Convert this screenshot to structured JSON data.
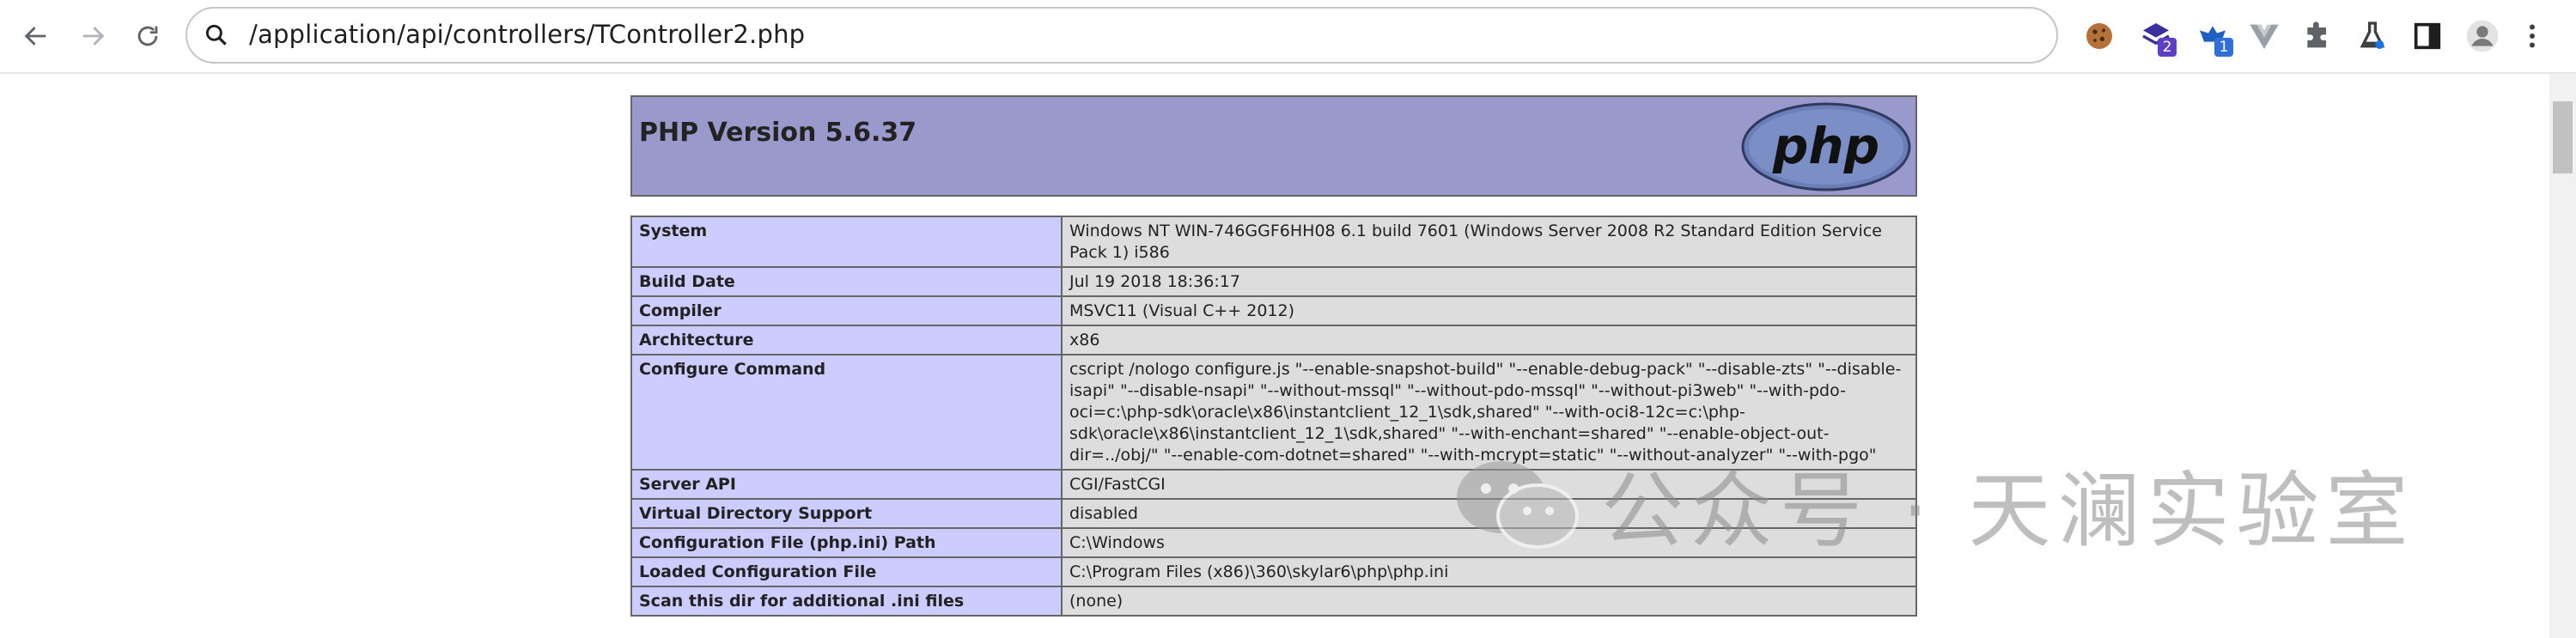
{
  "browser": {
    "url": "/application/api/controllers/TController2.php",
    "extensions": [
      {
        "name": "cookie-extension-icon"
      },
      {
        "name": "stack-extension-icon",
        "badge": "2"
      },
      {
        "name": "bird-extension-icon",
        "badge": "1"
      },
      {
        "name": "vue-devtools-icon"
      },
      {
        "name": "extensions-puzzle-icon"
      },
      {
        "name": "lab-flask-icon"
      },
      {
        "name": "side-panel-icon"
      },
      {
        "name": "profile-avatar-icon"
      },
      {
        "name": "more-menu-icon"
      }
    ],
    "colors": {
      "badge_blue": "#2f6fd6",
      "badge_purple": "#5b3fc4"
    }
  },
  "phpinfo": {
    "version_title": "PHP Version 5.6.37",
    "logo_text": "php",
    "rows": [
      {
        "label": "System",
        "value": "Windows NT WIN-746GGF6HH08 6.1 build 7601 (Windows Server 2008 R2 Standard Edition Service Pack 1) i586"
      },
      {
        "label": "Build Date",
        "value": "Jul 19 2018 18:36:17"
      },
      {
        "label": "Compiler",
        "value": "MSVC11 (Visual C++ 2012)"
      },
      {
        "label": "Architecture",
        "value": "x86"
      },
      {
        "label": "Configure Command",
        "value": "cscript /nologo configure.js \"--enable-snapshot-build\" \"--enable-debug-pack\" \"--disable-zts\" \"--disable-isapi\" \"--disable-nsapi\" \"--without-mssql\" \"--without-pdo-mssql\" \"--without-pi3web\" \"--with-pdo-oci=c:\\php-sdk\\oracle\\x86\\instantclient_12_1\\sdk,shared\" \"--with-oci8-12c=c:\\php-sdk\\oracle\\x86\\instantclient_12_1\\sdk,shared\" \"--with-enchant=shared\" \"--enable-object-out-dir=../obj/\" \"--enable-com-dotnet=shared\" \"--with-mcrypt=static\" \"--without-analyzer\" \"--with-pgo\""
      },
      {
        "label": "Server API",
        "value": "CGI/FastCGI"
      },
      {
        "label": "Virtual Directory Support",
        "value": "disabled"
      },
      {
        "label": "Configuration File (php.ini) Path",
        "value": "C:\\Windows"
      },
      {
        "label": "Loaded Configuration File",
        "value": "C:\\Program Files (x86)\\360\\skylar6\\php\\php.ini"
      },
      {
        "label": "Scan this dir for additional .ini files",
        "value": "(none)"
      }
    ],
    "colors": {
      "header": "#9999cc",
      "label_cell": "#ccccff",
      "value_cell": "#dddddd"
    }
  },
  "watermark": {
    "text": "公众号 · 天澜实验室",
    "icon": "wechat-icon"
  }
}
